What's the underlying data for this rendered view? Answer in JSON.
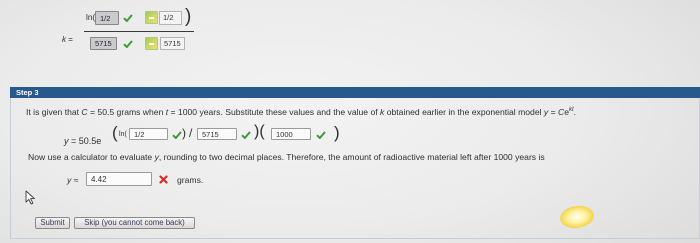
{
  "previous_step": {
    "variable": "k",
    "equals": " =",
    "ln_open": "ln(",
    "numerator_input": "1/2",
    "numerator_answer": "1/2",
    "close_paren": ")",
    "denominator_input": "5715",
    "denominator_answer": "5715"
  },
  "step": {
    "title": "Step 3",
    "instruction": [
      "It is given that ",
      "C",
      " = 50.5 grams when ",
      "t",
      " = 1000 years. Substitute these values and the value of ",
      "k",
      " obtained earlier in the exponential model ",
      "y",
      " = ",
      "C",
      "e",
      "kt",
      "."
    ],
    "equation": {
      "lhs": "y",
      "rhs": " = 50.5",
      "base": "e",
      "open_paren": "(",
      "ln_open": "ln(",
      "input_1": "1/2",
      "close_ln": ")",
      "divide": "/",
      "input_2": "5715",
      "mid_parens": ")(",
      "input_3": "1000",
      "close_paren": ")"
    },
    "evaluate": [
      "Now use a calculator to evaluate ",
      "y",
      ", rounding to two decimal places. Therefore, the amount of radioactive material left after 1000 years is"
    ],
    "result": {
      "variable": "y",
      "approx": " ≈",
      "value": "4.42",
      "unit": "grams."
    }
  },
  "buttons": {
    "submit": "Submit",
    "skip": "Skip (you cannot come back)"
  },
  "icons": {
    "correct": "check-icon",
    "incorrect": "cross-icon",
    "answer_key": "answer-key-icon",
    "cursor": "mouse-pointer-icon"
  },
  "colors": {
    "step_bar": "#27598c",
    "correct": "#3e9a36",
    "incorrect": "#d3302b"
  }
}
